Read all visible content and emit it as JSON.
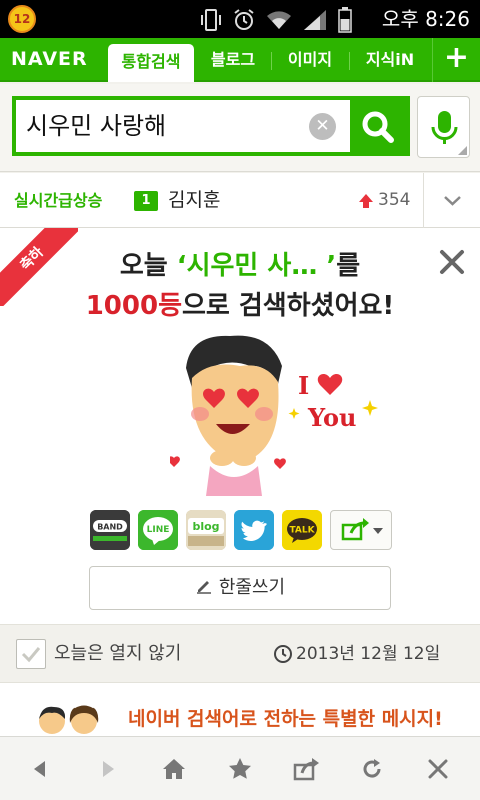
{
  "status_bar": {
    "badge": "12",
    "time": "오후 8:26"
  },
  "navbar": {
    "logo": "NAVER",
    "tabs": [
      {
        "label": "통합검색",
        "active": true
      },
      {
        "label": "블로그",
        "active": false
      },
      {
        "label": "이미지",
        "active": false
      },
      {
        "label": "지식iN",
        "active": false
      }
    ],
    "plus": "+"
  },
  "search": {
    "query": "시우민 사랑해"
  },
  "trending": {
    "label": "실시간급상승",
    "rank": "1",
    "term": "김지훈",
    "count": "354"
  },
  "card": {
    "ribbon": "축하",
    "headline_part1": "오늘 ",
    "headline_query": "‘시우민 사…  ’",
    "headline_part2": "를",
    "headline_rank": "1000등",
    "headline_part3": "으로 검색하셨어요!",
    "illustration_text": "I ♥ YOU",
    "share_buttons": [
      {
        "name": "band",
        "label": "BAND",
        "color": "#3a3a3a"
      },
      {
        "name": "line",
        "label": "LINE",
        "color": "#3cb72c"
      },
      {
        "name": "blog",
        "label": "blog",
        "color": "#c8b48a"
      },
      {
        "name": "twitter",
        "label": "",
        "color": "#2aa4d8"
      },
      {
        "name": "kakaotalk",
        "label": "TALK",
        "color": "#f3d800"
      }
    ],
    "write_button": "한줄쓰기"
  },
  "footer": {
    "checkbox_label": "오늘은 열지 않기",
    "date": "2013년 12월 12일"
  },
  "promo": {
    "text": "네이버 검색어로 전하는 특별한 메시지!"
  },
  "colors": {
    "brand_green": "#2db400",
    "accent_red": "#d8222b",
    "promo_orange": "#d8541c"
  }
}
